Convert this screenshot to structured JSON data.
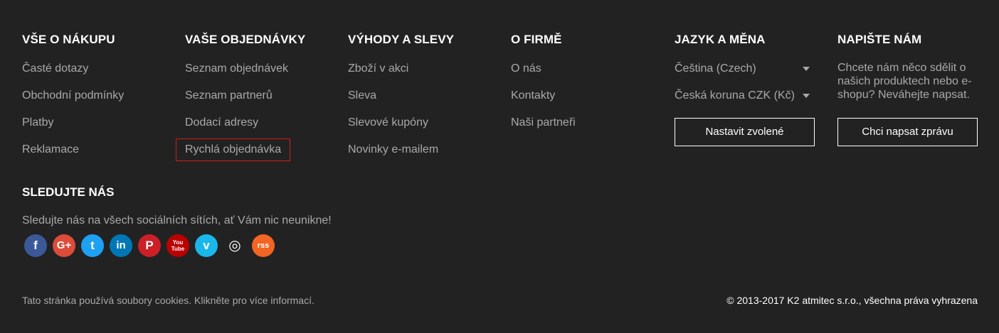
{
  "columns": {
    "shopping": {
      "title": "VŠE O NÁKUPU",
      "items": [
        "Časté dotazy",
        "Obchodní podmínky",
        "Platby",
        "Reklamace"
      ]
    },
    "orders": {
      "title": "VAŠE OBJEDNÁVKY",
      "items": [
        "Seznam objednávek",
        "Seznam partnerů",
        "Dodací adresy",
        "Rychlá objednávka"
      ]
    },
    "discounts": {
      "title": "VÝHODY A SLEVY",
      "items": [
        "Zboží v akci",
        "Sleva",
        "Slevové kupóny",
        "Novinky e-mailem"
      ]
    },
    "company": {
      "title": "O FIRMĚ",
      "items": [
        "O nás",
        "Kontakty",
        "Naši partneři"
      ]
    },
    "locale": {
      "title": "JAZYK A MĚNA",
      "language": "Čeština (Czech)",
      "currency": "Česká koruna CZK (Kč)",
      "button": "Nastavit zvolené"
    },
    "contact": {
      "title": "NAPIŠTE NÁM",
      "text": "Chcete nám něco sdělit o našich produktech nebo e-shopu? Neváhejte napsat.",
      "button": "Chci napsat zprávu"
    }
  },
  "social": {
    "title": "SLEDUJTE NÁS",
    "text": "Sledujte nás na všech sociálních sítích, ať Vám nic neunikne!",
    "icons": [
      {
        "name": "facebook-icon",
        "glyph": "f",
        "color": "#3b5998"
      },
      {
        "name": "google-plus-icon",
        "glyph": "G+",
        "color": "#dd4b39"
      },
      {
        "name": "twitter-icon",
        "glyph": "t",
        "color": "#1da1f2"
      },
      {
        "name": "linkedin-icon",
        "glyph": "in",
        "color": "#0077b5"
      },
      {
        "name": "pinterest-icon",
        "glyph": "P",
        "color": "#cb2027"
      },
      {
        "name": "youtube-icon",
        "glyph": "You Tube",
        "color": "#bb0000"
      },
      {
        "name": "vimeo-icon",
        "glyph": "v",
        "color": "#1ab7ea"
      },
      {
        "name": "instagram-icon",
        "glyph": "◎",
        "color": "#232222"
      },
      {
        "name": "rss-icon",
        "glyph": "rss",
        "color": "#f26522"
      }
    ]
  },
  "footer": {
    "cookies": "Tato stránka používá soubory cookies. Klikněte pro více informací.",
    "copyright": "© 2013-2017 K2 atmitec s.r.o., všechna práva vyhrazena"
  }
}
